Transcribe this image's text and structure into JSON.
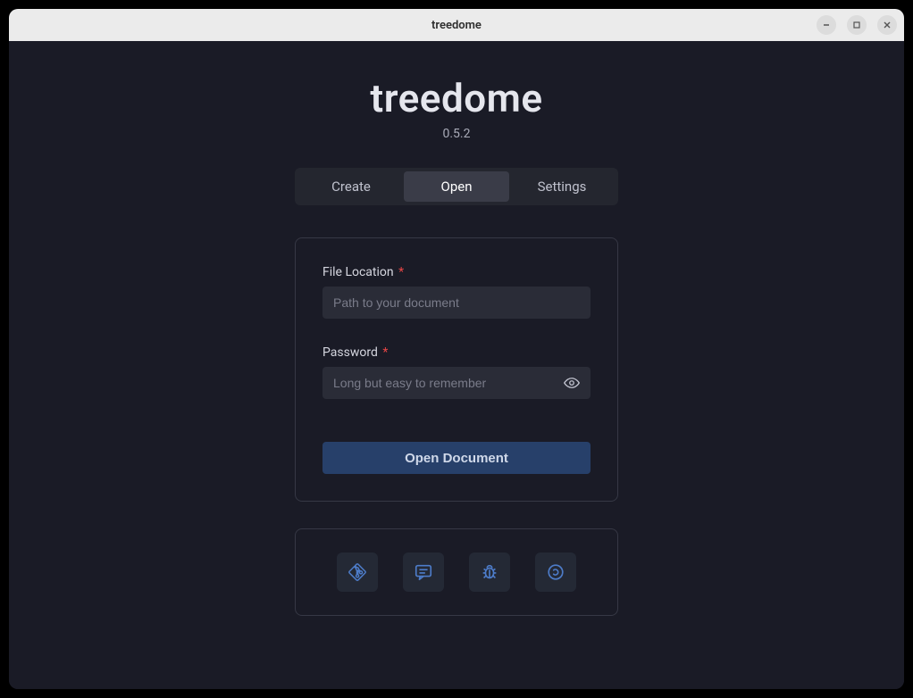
{
  "window": {
    "title": "treedome"
  },
  "app": {
    "title": "treedome",
    "version": "0.5.2"
  },
  "tabs": {
    "create": "Create",
    "open": "Open",
    "settings": "Settings",
    "active": "open"
  },
  "form": {
    "fileLocation": {
      "label": "File Location",
      "placeholder": "Path to your document",
      "value": ""
    },
    "password": {
      "label": "Password",
      "placeholder": "Long but easy to remember",
      "value": ""
    },
    "submit": "Open Document"
  },
  "icons": {
    "git": "git-icon",
    "chat": "chat-icon",
    "bug": "bug-icon",
    "license": "license-icon"
  },
  "colors": {
    "accent": "#4d7cc9",
    "bg": "#1a1b26",
    "card_border": "#363845"
  }
}
